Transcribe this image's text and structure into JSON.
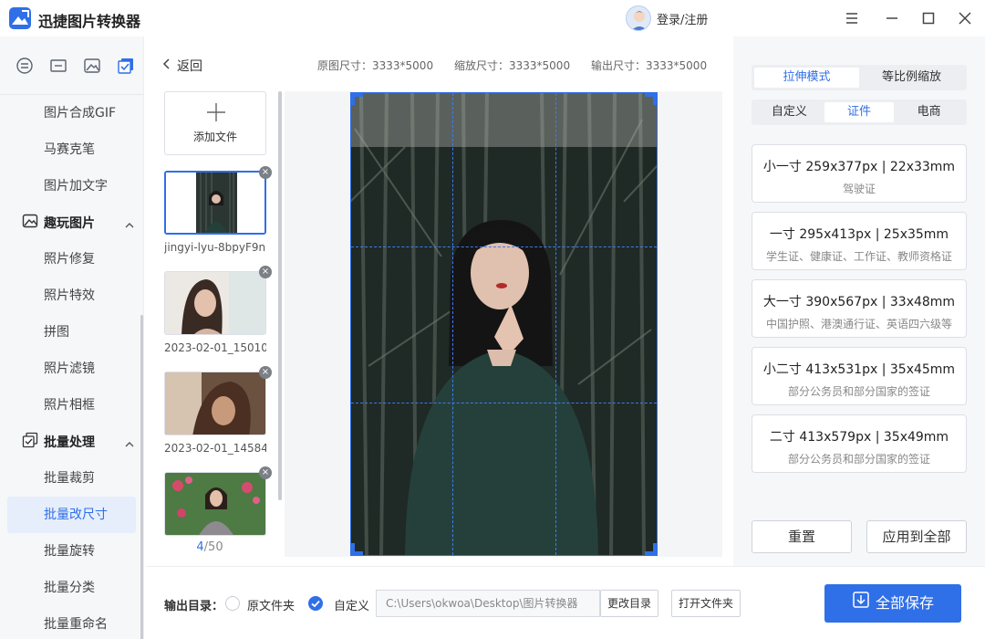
{
  "app": {
    "title": "迅捷图片转换器",
    "login_label": "登录/注册"
  },
  "window": {
    "icons": [
      "menu-icon",
      "minimize-icon",
      "maximize-icon",
      "close-icon"
    ]
  },
  "nav": {
    "tool_tabs": [
      "convert-icon",
      "tool-icon",
      "image-icon",
      "batch-icon"
    ],
    "items_top": [
      "图片合成GIF",
      "马赛克笔",
      "图片加文字"
    ],
    "group_fun": {
      "label": "趣玩图片",
      "items": [
        "照片修复",
        "照片特效",
        "拼图",
        "照片滤镜",
        "照片相框"
      ]
    },
    "group_batch": {
      "label": "批量处理",
      "items": [
        "批量裁剪",
        "批量改尺寸",
        "批量旋转",
        "批量分类",
        "批量重命名"
      ],
      "active": "批量改尺寸"
    }
  },
  "header": {
    "back_label": "返回",
    "original_size": "原图尺寸：3333*5000",
    "scaled_size": "缩放尺寸：3333*5000",
    "output_size": "输出尺寸：3333*5000"
  },
  "files": {
    "add_label": "添加文件",
    "items": [
      {
        "name": "jingyi-lyu-8bpyF9n..."
      },
      {
        "name": "2023-02-01_15010..."
      },
      {
        "name": "2023-02-01_14584..."
      },
      {
        "name": ""
      }
    ],
    "page_current": "4",
    "page_total": "/50"
  },
  "right": {
    "mode_tabs": [
      "拉伸模式",
      "等比例缩放"
    ],
    "mode_active": "拉伸模式",
    "preset_tabs": [
      "自定义",
      "证件",
      "电商"
    ],
    "preset_active": "证件",
    "cards": [
      {
        "title": "小一寸 259x377px | 22x33mm",
        "desc": "驾驶证"
      },
      {
        "title": "一寸 295x413px | 25x35mm",
        "desc": "学生证、健康证、工作证、教师资格证"
      },
      {
        "title": "大一寸 390x567px | 33x48mm",
        "desc": "中国护照、港澳通行证、英语四六级等"
      },
      {
        "title": "小二寸 413x531px | 35x45mm",
        "desc": "部分公务员和部分国家的签证"
      },
      {
        "title": "二寸 413x579px | 35x49mm",
        "desc": "部分公务员和部分国家的签证"
      }
    ],
    "reset_label": "重置",
    "apply_all_label": "应用到全部"
  },
  "bottom": {
    "output_dir_label": "输出目录：",
    "option_original": "原文件夹",
    "option_custom": "自定义",
    "selected": "自定义",
    "path_value": "C:\\Users\\okwoa\\Desktop\\图片转换器",
    "change_dir_label": "更改目录",
    "open_folder_label": "打开文件夹",
    "save_all_label": "全部保存"
  },
  "colors": {
    "accent": "#2f6fe8",
    "panel_bg": "#f6f7f9"
  }
}
